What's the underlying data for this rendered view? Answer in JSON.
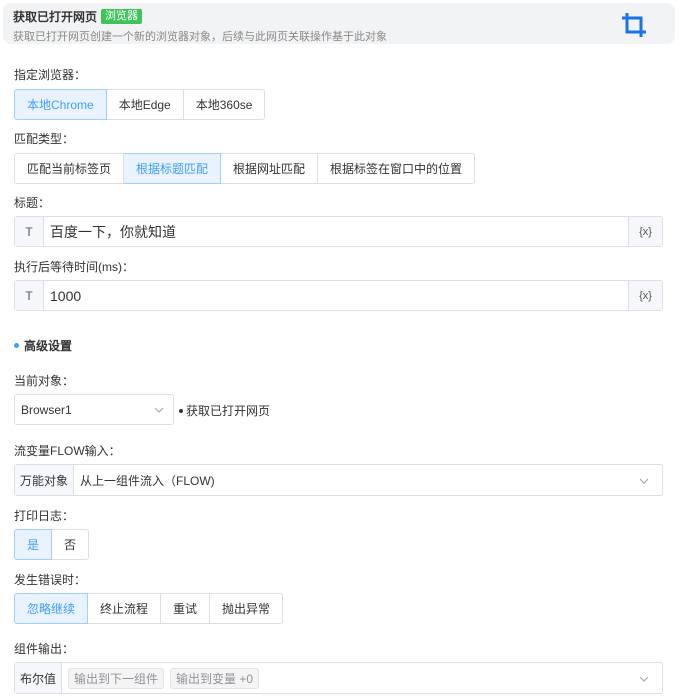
{
  "header": {
    "title": "获取已打开网页",
    "badge": "浏览器",
    "description": "获取已打开网页创建一个新的浏览器对象，后续与此网页关联操作基于此对象",
    "icon": "crop-icon",
    "accent": "#1a73e8"
  },
  "browser": {
    "label": "指定浏览器：",
    "options": [
      "本地Chrome",
      "本地Edge",
      "本地360se"
    ],
    "selected": "本地Chrome"
  },
  "match": {
    "label": "匹配类型：",
    "options": [
      "匹配当前标签页",
      "根据标题匹配",
      "根据网址匹配",
      "根据标签在窗口中的位置"
    ],
    "selected": "根据标题匹配"
  },
  "title_field": {
    "label": "标题：",
    "prefix": "T",
    "value": "百度一下，你就知道",
    "suffix": "{x}"
  },
  "wait_field": {
    "label": "执行后等待时间(ms)：",
    "prefix": "T",
    "value": "1000",
    "suffix": "{x}"
  },
  "advanced": {
    "title": "高级设置"
  },
  "current_object": {
    "label": "当前对象：",
    "value": "Browser1",
    "note": "获取已打开网页"
  },
  "flow_input": {
    "label": "流变量FLOW输入：",
    "prefix": "万能对象",
    "value": "从上一组件流入（FLOW)"
  },
  "print_log": {
    "label": "打印日志：",
    "options": [
      "是",
      "否"
    ],
    "selected": "是"
  },
  "on_error": {
    "label": "发生错误时：",
    "options": [
      "忽略继续",
      "终止流程",
      "重试",
      "抛出异常"
    ],
    "selected": "忽略继续"
  },
  "output": {
    "label": "组件输出：",
    "prefix": "布尔值",
    "tags": [
      "输出到下一组件",
      "输出到变量 +0"
    ]
  },
  "colors": {
    "active_bg": "#e8f3ff",
    "active_text": "#409eff",
    "badge_bg": "#3cc35a"
  }
}
